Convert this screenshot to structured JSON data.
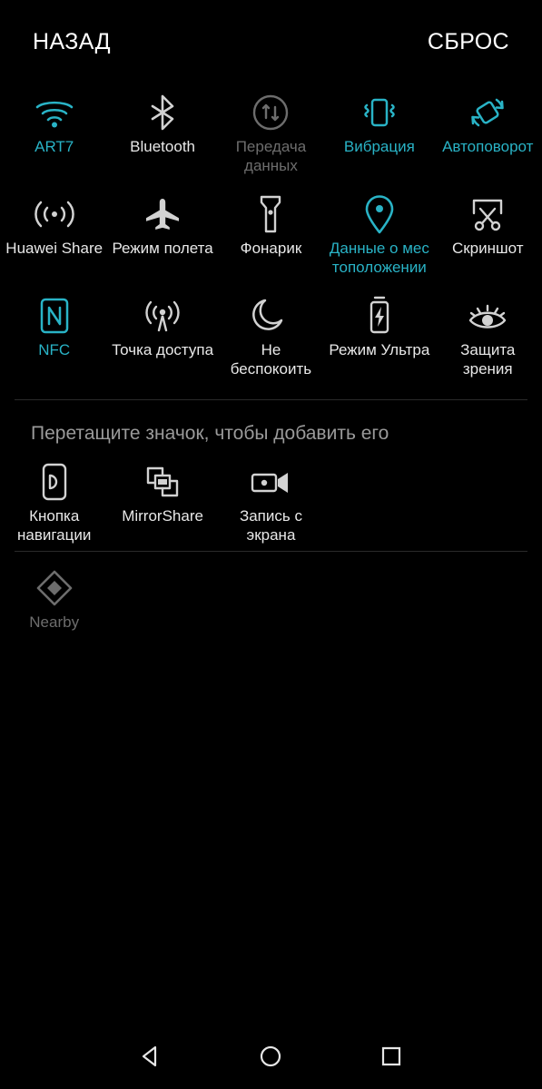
{
  "header": {
    "back_label": "НАЗАД",
    "reset_label": "СБРОС"
  },
  "colors": {
    "background": "#000000",
    "accent_on": "#29b3c6",
    "label_off": "#e8e8e8",
    "label_disabled": "#6d6d6d",
    "divider": "#2a2a2a"
  },
  "active_toggles": {
    "icon_names": [
      "wifi-icon",
      "bluetooth-icon",
      "mobile-data-icon",
      "vibration-icon",
      "auto-rotate-icon",
      "huawei-share-icon",
      "airplane-mode-icon",
      "flashlight-icon",
      "location-icon",
      "screenshot-icon",
      "nfc-icon",
      "hotspot-icon",
      "do-not-disturb-icon",
      "ultra-power-saving-icon",
      "eye-comfort-icon"
    ],
    "items": [
      {
        "label": "ART7",
        "state": "on",
        "icon": "wifi-icon"
      },
      {
        "label": "Bluetooth",
        "state": "off",
        "icon": "bluetooth-icon"
      },
      {
        "label": "Передача данных",
        "state": "disabled",
        "icon": "mobile-data-icon"
      },
      {
        "label": "Вибрация",
        "state": "on",
        "icon": "vibration-icon"
      },
      {
        "label": "Автоповорот",
        "state": "on",
        "icon": "auto-rotate-icon"
      },
      {
        "label": "Huawei Share",
        "state": "off",
        "icon": "huawei-share-icon"
      },
      {
        "label": "Режим полета",
        "state": "off",
        "icon": "airplane-mode-icon"
      },
      {
        "label": "Фонарик",
        "state": "off",
        "icon": "flashlight-icon"
      },
      {
        "label": "Данные о мес тоположении",
        "state": "on",
        "icon": "location-icon"
      },
      {
        "label": "Скриншот",
        "state": "off",
        "icon": "screenshot-icon"
      },
      {
        "label": "NFC",
        "state": "on",
        "icon": "nfc-icon"
      },
      {
        "label": "Точка доступа",
        "state": "off",
        "icon": "hotspot-icon"
      },
      {
        "label": "Не беспокоить",
        "state": "off",
        "icon": "do-not-disturb-icon"
      },
      {
        "label": "Режим Ультра",
        "state": "off",
        "icon": "ultra-power-saving-icon"
      },
      {
        "label": "Защита зрения",
        "state": "off",
        "icon": "eye-comfort-icon"
      }
    ]
  },
  "add_section": {
    "hint": "Перетащите значок, чтобы добавить его",
    "items": [
      {
        "label": "Кнопка навигации",
        "state": "off",
        "icon": "navigation-button-icon"
      },
      {
        "label": "MirrorShare",
        "state": "off",
        "icon": "mirror-share-icon"
      },
      {
        "label": "Запись с экрана",
        "state": "off",
        "icon": "screen-record-icon"
      }
    ]
  },
  "nearby_section": {
    "items": [
      {
        "label": "Nearby",
        "state": "disabled",
        "icon": "nearby-icon"
      }
    ]
  },
  "navbar": {
    "back_label": "back-button",
    "home_label": "home-button",
    "recents_label": "recents-button"
  }
}
